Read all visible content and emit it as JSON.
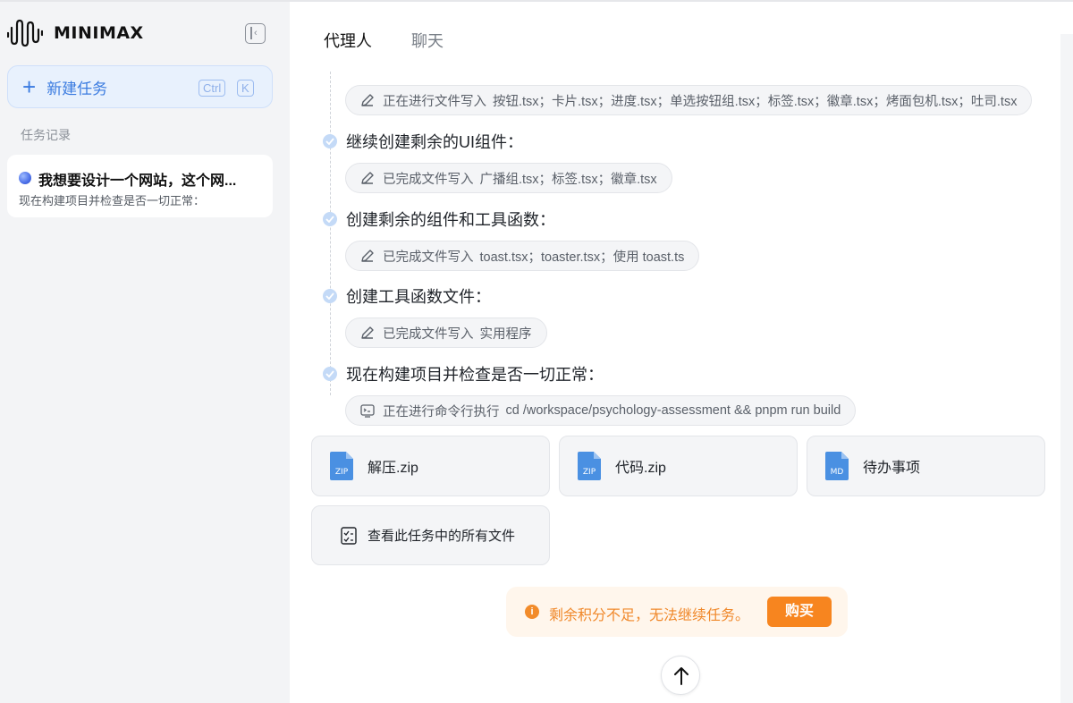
{
  "app": {
    "brand": "MINIMAX",
    "logo_icon": "waveform-logo-icon"
  },
  "sidebar": {
    "new_task_label": "新建任务",
    "shortcut_keys": [
      "Ctrl",
      "K"
    ],
    "history_title": "任务记录",
    "tasks": [
      {
        "title": "我想要设计一个网站，这个网...",
        "subtitle": "现在构建项目并检查是否一切正常：",
        "status_color": "#4b6fe8"
      }
    ]
  },
  "tabs": [
    {
      "label": "代理人",
      "active": true
    },
    {
      "label": "聊天",
      "active": false
    }
  ],
  "steps": [
    {
      "pill": {
        "icon": "edit-icon",
        "action": "正在进行文件写入",
        "detail": "按钮.tsx；卡片.tsx；进度.tsx；单选按钮组.tsx；标签.tsx；徽章.tsx；烤面包机.tsx；吐司.tsx"
      }
    },
    {
      "title": "继续创建剩余的UI组件：",
      "pill": {
        "icon": "edit-icon",
        "action": "已完成文件写入",
        "detail": "广播组.tsx；标签.tsx；徽章.tsx"
      }
    },
    {
      "title": "创建剩余的组件和工具函数：",
      "pill": {
        "icon": "edit-icon",
        "action": "已完成文件写入",
        "detail": "toast.tsx；toaster.tsx；使用 toast.ts"
      }
    },
    {
      "title": "创建工具函数文件：",
      "pill": {
        "icon": "edit-icon",
        "action": "已完成文件写入",
        "detail": "实用程序"
      }
    },
    {
      "title": "现在构建项目并检查是否一切正常：",
      "pill": {
        "icon": "terminal-icon",
        "action": "正在进行命令行执行",
        "detail": "cd /workspace/psychology-assessment && pnpm run build"
      }
    }
  ],
  "files": [
    {
      "name": "解压.zip",
      "badge": "ZIP"
    },
    {
      "name": "代码.zip",
      "badge": "ZIP"
    },
    {
      "name": "待办事项",
      "badge": "MD"
    }
  ],
  "view_all_files": "查看此任务中的所有文件",
  "credit_warning": {
    "message": "剩余积分不足，无法继续任务。",
    "button": "购买",
    "color": "#f7851f"
  },
  "colors": {
    "accent": "#3a7be0",
    "file_icon": "#4a90e2"
  }
}
